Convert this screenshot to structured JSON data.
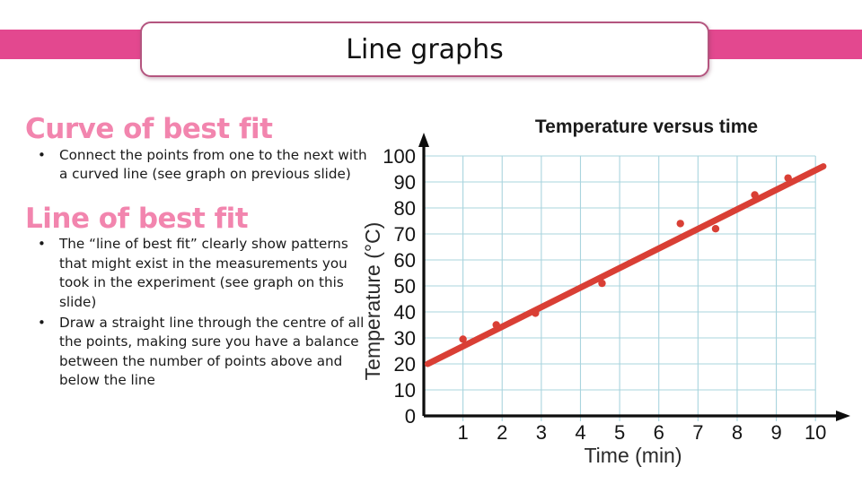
{
  "slide": {
    "title": "Line graphs"
  },
  "theme": {
    "banner_pink": "#e3488f",
    "plate_border": "#b4557f",
    "heading_pink": "#f285ae",
    "body_text": "#1a1a1a",
    "grid_blue": "#a9d4de",
    "data_red": "#d93f35",
    "axis_black": "#0d0d0d"
  },
  "content": {
    "sections": [
      {
        "heading": "Curve of best fit",
        "bullets": [
          "Connect the points from one to the next with a curved line (see graph on previous slide)"
        ]
      },
      {
        "heading": "Line of best fit",
        "bullets": [
          "The “line of best fit” clearly show patterns that might exist in the measurements you took in the experiment (see graph on this slide)",
          "Draw a straight line through the centre of all the points, making sure you have a balance between the number of points above and below the line"
        ]
      }
    ],
    "bullet_glyph": "•"
  },
  "chart_data": {
    "type": "scatter",
    "title": "Temperature versus time",
    "xlabel": "Time (min)",
    "ylabel": "Temperature (°C)",
    "xlim": [
      0,
      10.5
    ],
    "ylim": [
      0,
      100
    ],
    "xticks": [
      1,
      2,
      3,
      4,
      5,
      6,
      7,
      8,
      9,
      10
    ],
    "yticks": [
      0,
      10,
      20,
      30,
      40,
      50,
      60,
      70,
      80,
      90,
      100
    ],
    "grid": true,
    "legend": "none",
    "points": [
      {
        "x": 1.0,
        "y": 29.5
      },
      {
        "x": 1.85,
        "y": 35.0
      },
      {
        "x": 2.85,
        "y": 39.5
      },
      {
        "x": 4.55,
        "y": 51.0
      },
      {
        "x": 6.55,
        "y": 74.0
      },
      {
        "x": 7.45,
        "y": 72.0
      },
      {
        "x": 8.45,
        "y": 85.0
      },
      {
        "x": 9.3,
        "y": 91.5
      }
    ],
    "trend_line": {
      "name": "line of best fit",
      "x_start": 0.1,
      "y_start": 20,
      "x_end": 10.2,
      "y_end": 96
    }
  }
}
